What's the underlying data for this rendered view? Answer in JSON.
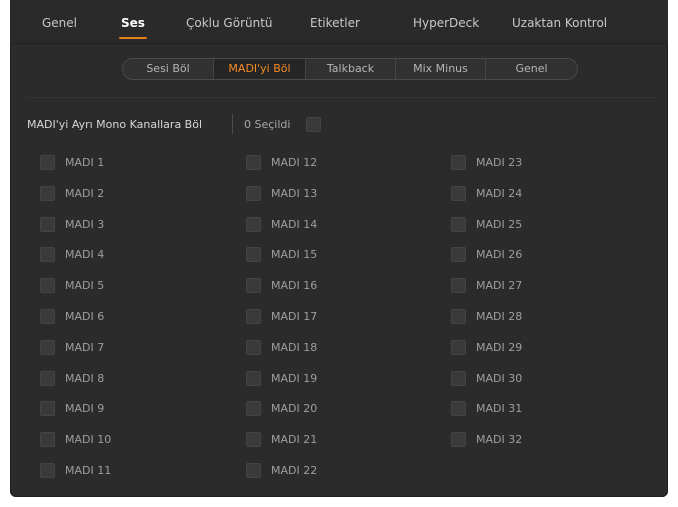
{
  "tabs": [
    "Genel",
    "Ses",
    "Çoklu Görüntü",
    "Etiketler",
    "HyperDeck",
    "Uzaktan Kontrol"
  ],
  "active_tab": "Ses",
  "subtabs": [
    "Sesi Böl",
    "MADI'yi Böl",
    "Talkback",
    "Mix Minus",
    "Genel"
  ],
  "active_subtab": "MADI'yi Böl",
  "split": {
    "label": "MADI'yi Ayrı Mono Kanallara Böl",
    "selected_text": "0 Seçildi"
  },
  "channels": [
    "MADI 1",
    "MADI 2",
    "MADI 3",
    "MADI 4",
    "MADI 5",
    "MADI 6",
    "MADI 7",
    "MADI 8",
    "MADI 9",
    "MADI 10",
    "MADI 11",
    "MADI 12",
    "MADI 13",
    "MADI 14",
    "MADI 15",
    "MADI 16",
    "MADI 17",
    "MADI 18",
    "MADI 19",
    "MADI 20",
    "MADI 21",
    "MADI 22",
    "MADI 23",
    "MADI 24",
    "MADI 25",
    "MADI 26",
    "MADI 27",
    "MADI 28",
    "MADI 29",
    "MADI 30",
    "MADI 31",
    "MADI 32"
  ],
  "colors": {
    "accent": "#e87d1e",
    "active_subtab_text": "#f28a26",
    "panel": "#2b2b2b"
  }
}
